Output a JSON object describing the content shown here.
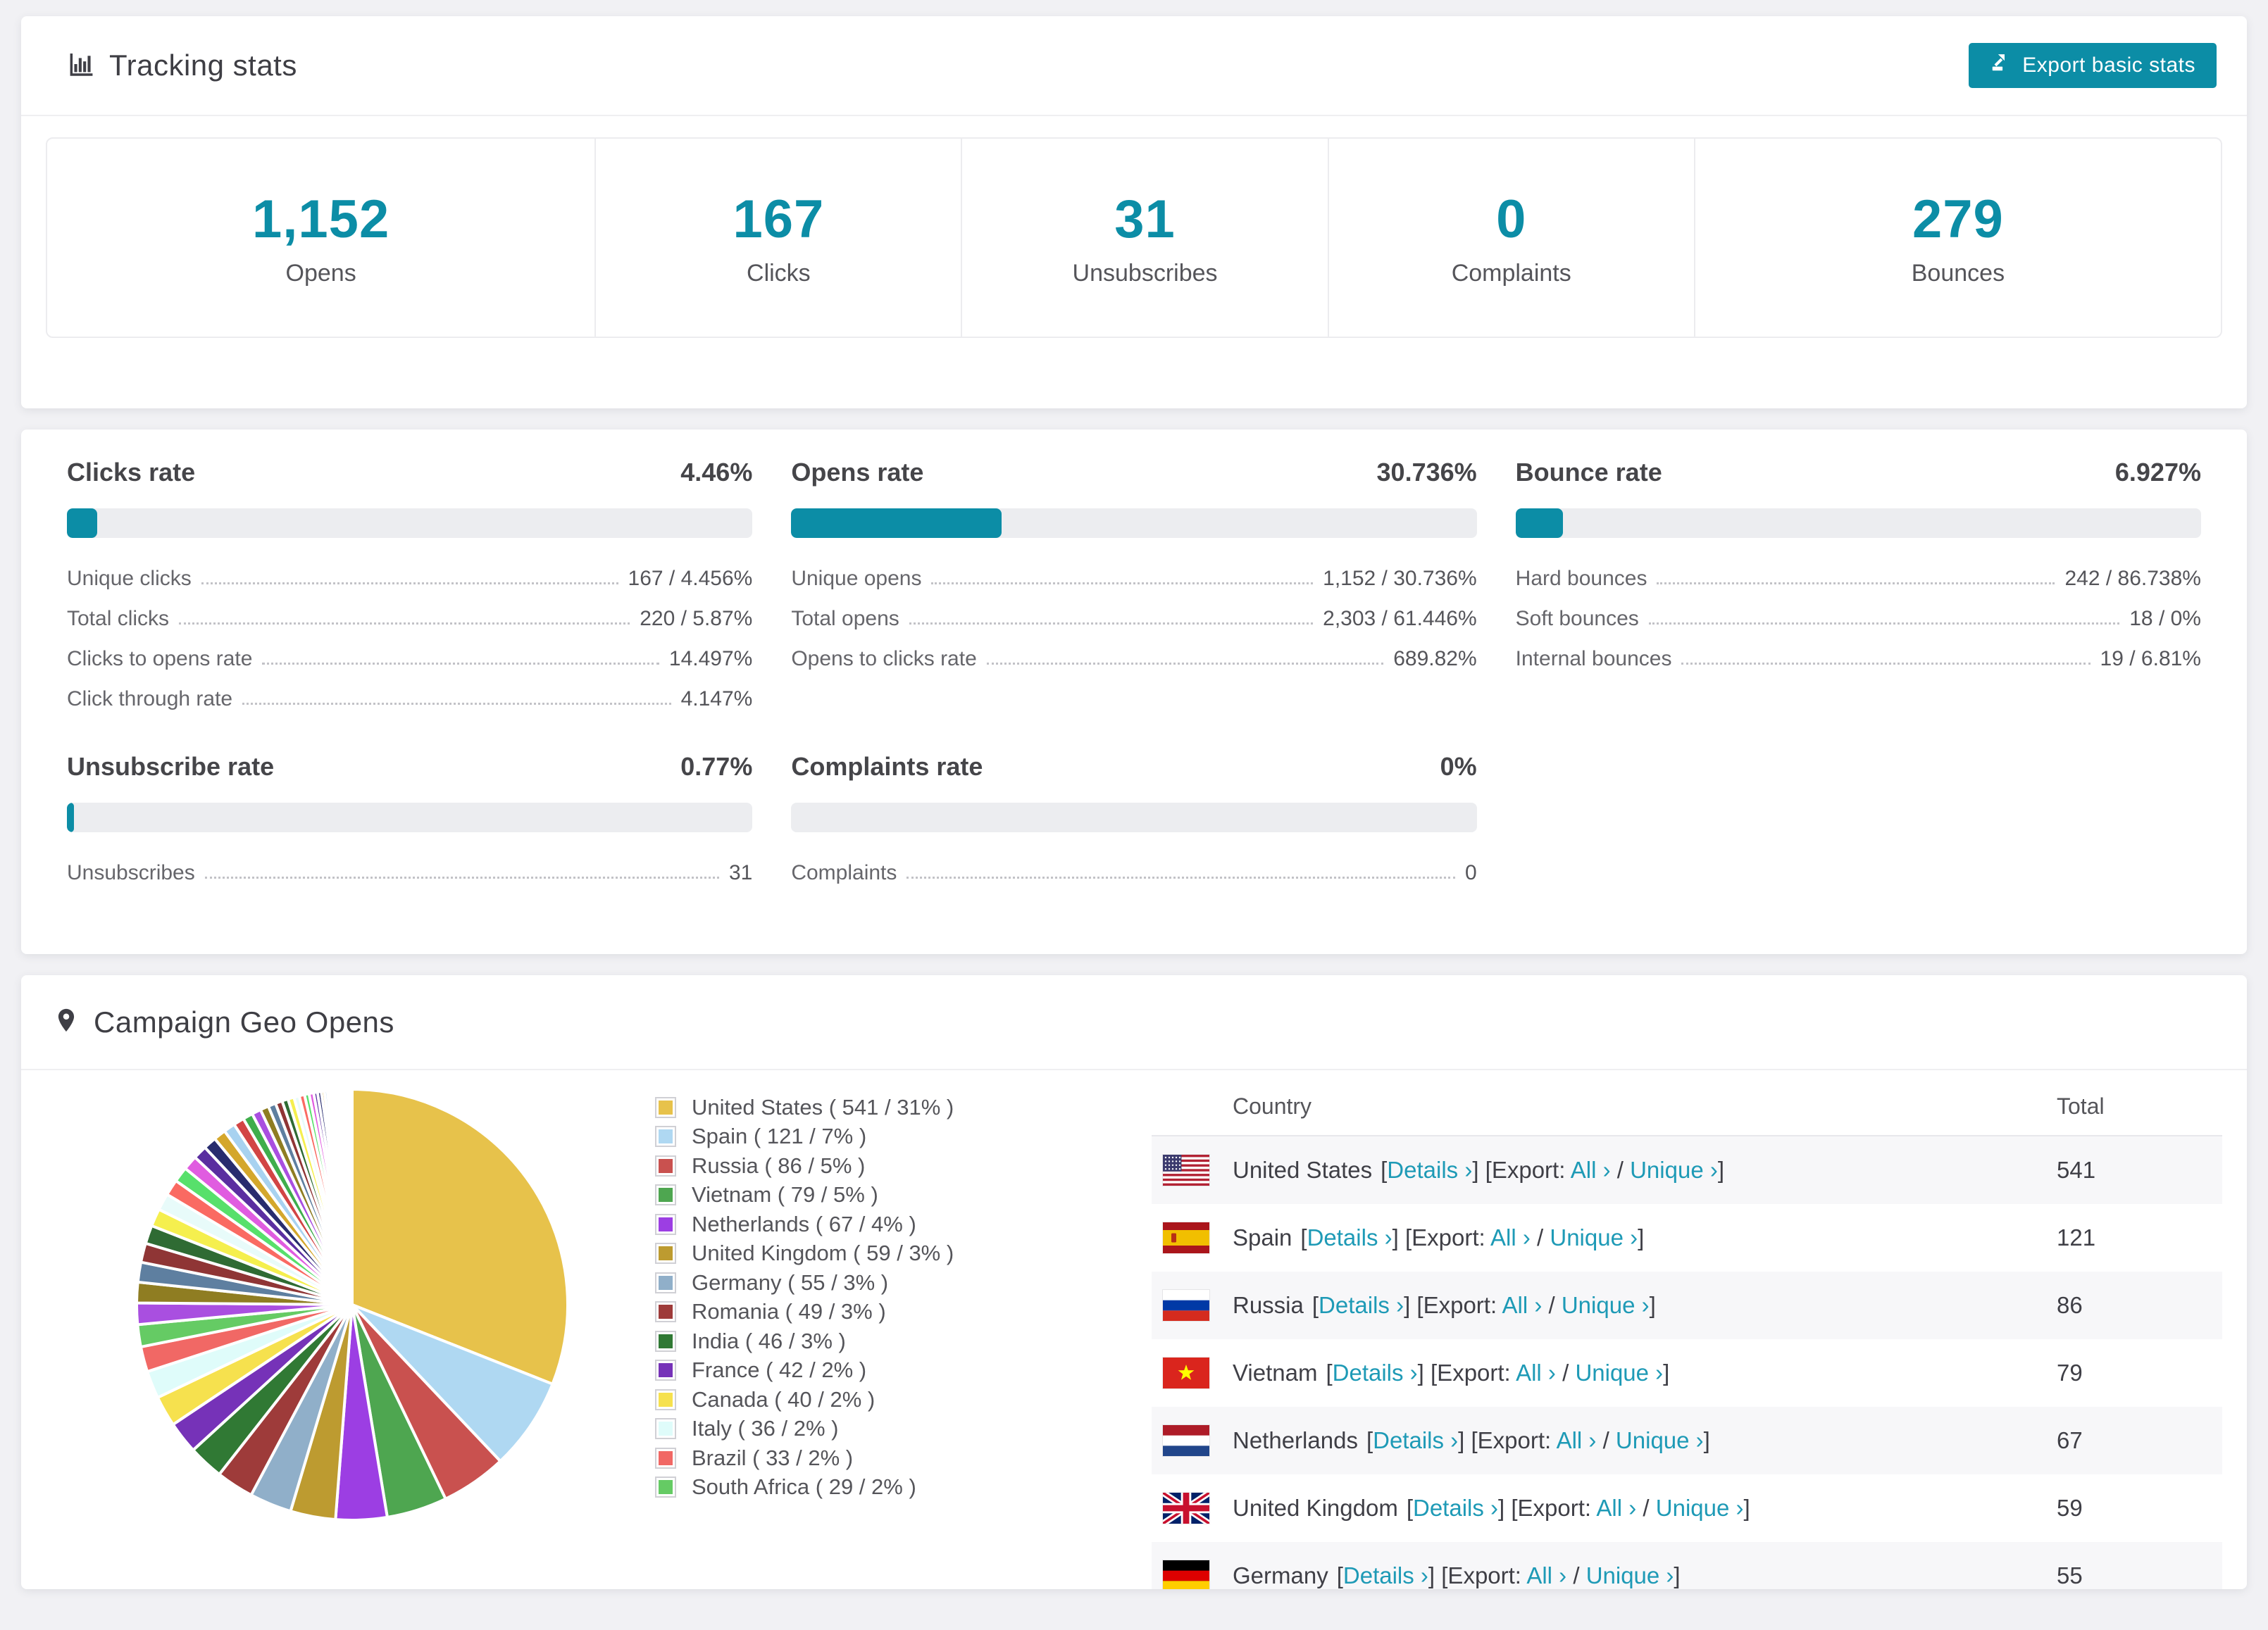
{
  "colors": {
    "accent": "#0c8da6",
    "link": "#1e9ab6",
    "bar_background": "#ecedf0",
    "page_background": "#f1f1f4",
    "row_stripe": "#f7f7f9"
  },
  "header": {
    "title": "Tracking stats",
    "export_label": "Export basic stats"
  },
  "stats": {
    "items": [
      {
        "value": "1,152",
        "label": "Opens"
      },
      {
        "value": "167",
        "label": "Clicks"
      },
      {
        "value": "31",
        "label": "Unsubscribes"
      },
      {
        "value": "0",
        "label": "Complaints"
      },
      {
        "value": "279",
        "label": "Bounces"
      }
    ]
  },
  "rates": {
    "blocks": [
      {
        "title": "Clicks rate",
        "value": "4.46%",
        "percent": 4.46,
        "rows": [
          {
            "label": "Unique clicks",
            "value": "167 / 4.456%"
          },
          {
            "label": "Total clicks",
            "value": "220 / 5.87%"
          },
          {
            "label": "Clicks to opens rate",
            "value": "14.497%"
          },
          {
            "label": "Click through rate",
            "value": "4.147%"
          }
        ]
      },
      {
        "title": "Opens rate",
        "value": "30.736%",
        "percent": 30.736,
        "rows": [
          {
            "label": "Unique opens",
            "value": "1,152 / 30.736%"
          },
          {
            "label": "Total opens",
            "value": "2,303 / 61.446%"
          },
          {
            "label": "Opens to clicks rate",
            "value": "689.82%"
          }
        ]
      },
      {
        "title": "Bounce rate",
        "value": "6.927%",
        "percent": 6.927,
        "rows": [
          {
            "label": "Hard bounces",
            "value": "242 / 86.738%"
          },
          {
            "label": "Soft bounces",
            "value": "18 / 0%"
          },
          {
            "label": "Internal bounces",
            "value": "19 / 6.81%"
          }
        ]
      },
      {
        "title": "Unsubscribe rate",
        "value": "0.77%",
        "percent": 0.77,
        "rows": [
          {
            "label": "Unsubscribes",
            "value": "31"
          }
        ]
      },
      {
        "title": "Complaints rate",
        "value": "0%",
        "percent": 0,
        "rows": [
          {
            "label": "Complaints",
            "value": "0"
          }
        ]
      }
    ]
  },
  "geo": {
    "title": "Campaign Geo Opens",
    "chart_data": {
      "type": "pie",
      "title": "Campaign Geo Opens",
      "legend_position": "right",
      "series": [
        {
          "label": "United States",
          "value": 541,
          "pct": 31,
          "color": "#e7c24b"
        },
        {
          "label": "Spain",
          "value": 121,
          "pct": 7,
          "color": "#afd8f2"
        },
        {
          "label": "Russia",
          "value": 86,
          "pct": 5,
          "color": "#c9514f"
        },
        {
          "label": "Vietnam",
          "value": 79,
          "pct": 5,
          "color": "#4ea650"
        },
        {
          "label": "Netherlands",
          "value": 67,
          "pct": 4,
          "color": "#9c3ee3"
        },
        {
          "label": "United Kingdom",
          "value": 59,
          "pct": 3,
          "color": "#bd9b30"
        },
        {
          "label": "Germany",
          "value": 55,
          "pct": 3,
          "color": "#90afc9"
        },
        {
          "label": "Romania",
          "value": 49,
          "pct": 3,
          "color": "#9e3b3a"
        },
        {
          "label": "India",
          "value": 46,
          "pct": 3,
          "color": "#307934"
        },
        {
          "label": "France",
          "value": 42,
          "pct": 2,
          "color": "#7632b8"
        },
        {
          "label": "Canada",
          "value": 40,
          "pct": 2,
          "color": "#f6e14e"
        },
        {
          "label": "Italy",
          "value": 36,
          "pct": 2,
          "color": "#dffcfa"
        },
        {
          "label": "Brazil",
          "value": 33,
          "pct": 2,
          "color": "#f16865"
        },
        {
          "label": "South Africa",
          "value": 29,
          "pct": 2,
          "color": "#65cb64"
        }
      ],
      "others_values": [
        28,
        27,
        26,
        25,
        24,
        23,
        22,
        21,
        20,
        19,
        18,
        17,
        16,
        15,
        14,
        13,
        12,
        11,
        10,
        9,
        8,
        8,
        7,
        7,
        6,
        6,
        5,
        5,
        4,
        4,
        3,
        3,
        3,
        3,
        2,
        2,
        2,
        2,
        2,
        2,
        1,
        1,
        1,
        1,
        1,
        1,
        1,
        1
      ],
      "others_palette": [
        "#a94fe0",
        "#8f7d22",
        "#5e7fa0",
        "#8f3535",
        "#2f6b33",
        "#f5ef4e",
        "#e8fbfa",
        "#fa6a62",
        "#57e06b",
        "#e05ce0",
        "#5a2ea0",
        "#282c6e",
        "#d4a72c",
        "#a8d2f0",
        "#d24545",
        "#3fae4c"
      ]
    },
    "legend_format": {
      "open": "(",
      "separator": "/",
      "close": ")"
    },
    "table": {
      "headers": [
        "Country",
        "Total"
      ],
      "links": {
        "details": "Details ›",
        "export_label": "Export:",
        "all": "All ›",
        "unique": "Unique ›"
      },
      "rows": [
        {
          "country": "United States",
          "flag": "us",
          "total": "541"
        },
        {
          "country": "Spain",
          "flag": "es",
          "total": "121"
        },
        {
          "country": "Russia",
          "flag": "ru",
          "total": "86"
        },
        {
          "country": "Vietnam",
          "flag": "vn",
          "total": "79"
        },
        {
          "country": "Netherlands",
          "flag": "nl",
          "total": "67"
        },
        {
          "country": "United Kingdom",
          "flag": "gb",
          "total": "59"
        },
        {
          "country": "Germany",
          "flag": "de",
          "total": "55"
        }
      ]
    }
  }
}
